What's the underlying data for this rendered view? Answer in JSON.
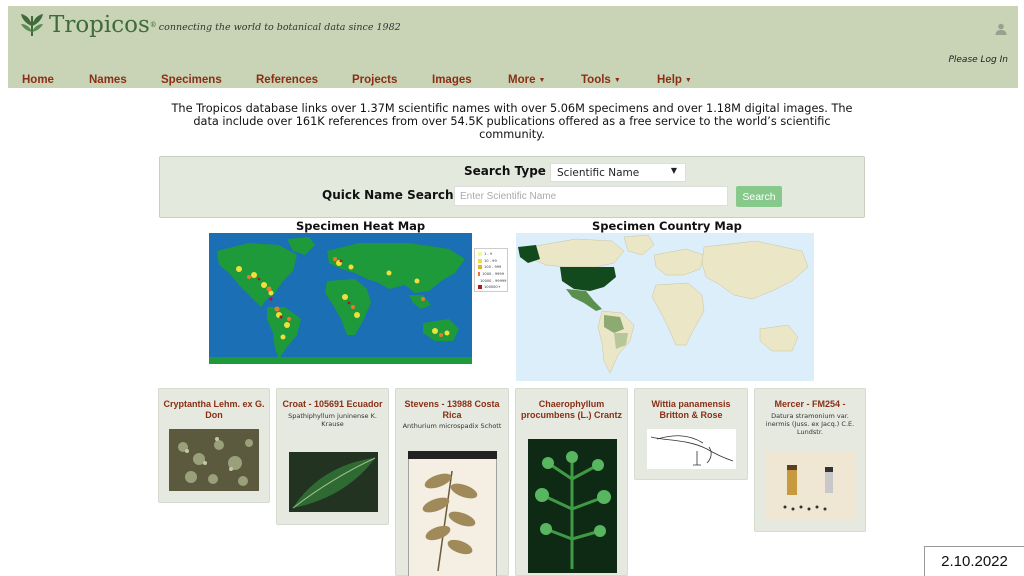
{
  "header": {
    "logo_name": "Tropicos",
    "logo_reg": "®",
    "tagline": "connecting the world to botanical data since 1982",
    "login": "Please Log In"
  },
  "nav": [
    {
      "label": "Home",
      "dropdown": false
    },
    {
      "label": "Names",
      "dropdown": false
    },
    {
      "label": "Specimens",
      "dropdown": false
    },
    {
      "label": "References",
      "dropdown": false
    },
    {
      "label": "Projects",
      "dropdown": false
    },
    {
      "label": "Images",
      "dropdown": false
    },
    {
      "label": "More",
      "dropdown": true
    },
    {
      "label": "Tools",
      "dropdown": true
    },
    {
      "label": "Help",
      "dropdown": true
    }
  ],
  "intro": "The Tropicos database links over 1.37M scientific names with over 5.06M specimens and over 1.18M digital images. The data include over 161K references from over 54.5K publications offered as a free service to the world’s scientific community.",
  "search": {
    "type_label": "Search Type",
    "type_value": "Scientific Name",
    "quick_label": "Quick Name Search",
    "placeholder": "Enter Scientific Name",
    "button": "Search"
  },
  "maps": {
    "heat_title": "Specimen Heat Map",
    "country_title": "Specimen Country Map",
    "legend": [
      {
        "label": "1 - 9",
        "color": "#f7f79a"
      },
      {
        "label": "10 - 99",
        "color": "#f2df3a"
      },
      {
        "label": "100 - 999",
        "color": "#f0a832"
      },
      {
        "label": "1000 - 9999",
        "color": "#e87a2b"
      },
      {
        "label": "10000 - 99999",
        "color": "#d94a1f"
      },
      {
        "label": "100000+",
        "color": "#b51818"
      }
    ]
  },
  "cards": [
    {
      "title": "Cryptantha Lehm. ex G. Don",
      "subtitle": ""
    },
    {
      "title": "Croat - 105691 Ecuador",
      "subtitle": "Spathiphyllum juninense K. Krause"
    },
    {
      "title": "Stevens - 13988 Costa Rica",
      "subtitle": "Anthurium microspadix Schott"
    },
    {
      "title": "Chaerophyllum procumbens (L.) Crantz",
      "subtitle": ""
    },
    {
      "title": "Wittia panamensis Britton & Rose",
      "subtitle": ""
    },
    {
      "title": "Mercer - FM254 -",
      "subtitle": "Datura stramonium var. inermis (Juss. ex Jacq.) C.E. Lundstr."
    }
  ],
  "footer_date": "2.10.2022",
  "colors": {
    "header_bg": "#c9d4b7",
    "nav_text": "#8a2f14",
    "logo_green": "#3f6b3a",
    "search_btn": "#86c98a",
    "ocean_heat": "#1a6fb5",
    "land_heat": "#1e9a3a"
  }
}
